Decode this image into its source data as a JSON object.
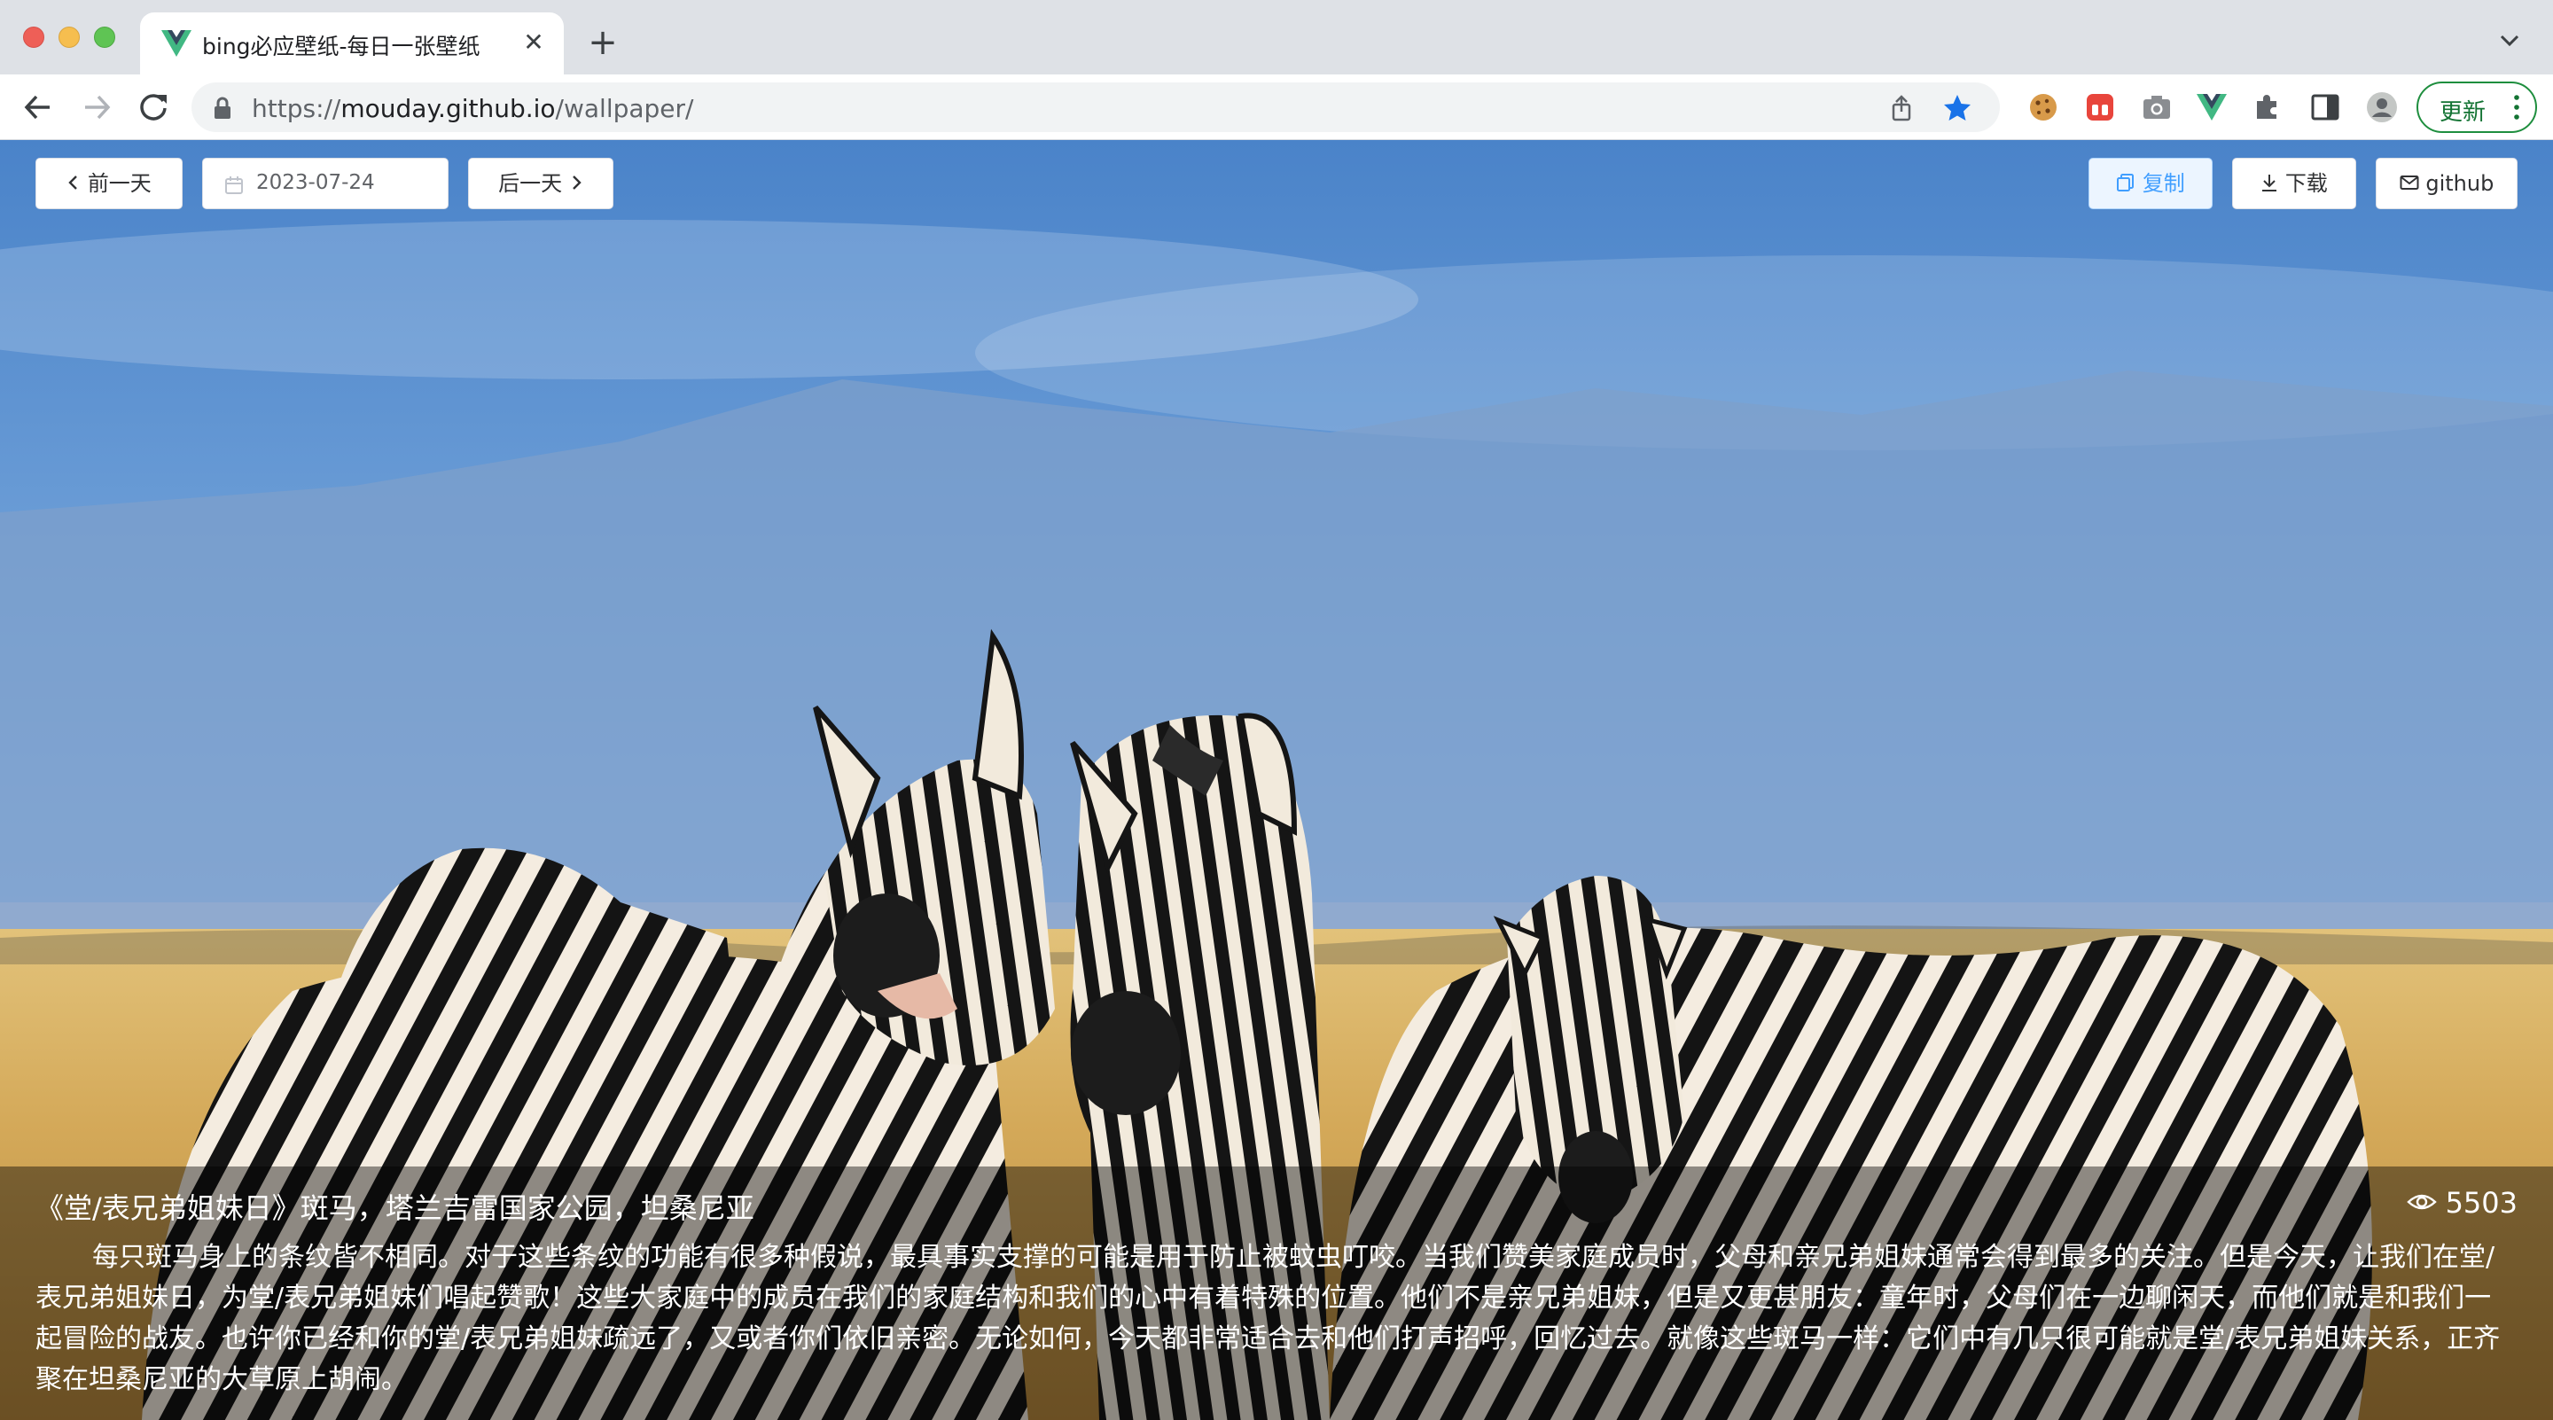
{
  "browser": {
    "tab_title": "bing必应壁纸-每日一张壁纸",
    "url_prefix": "https://",
    "url_host": "mouday.github.io",
    "url_path": "/wallpaper/",
    "update_label": "更新"
  },
  "toolbar": {
    "prev_label": "前一天",
    "date_value": "2023-07-24",
    "next_label": "后一天",
    "copy_label": "复制",
    "download_label": "下载",
    "github_label": "github"
  },
  "caption": {
    "title": "《堂/表兄弟姐妹日》斑马，塔兰吉雷国家公园，坦桑尼亚",
    "views": "5503",
    "description": "每只斑马身上的条纹皆不相同。对于这些条纹的功能有很多种假说，最具事实支撑的可能是用于防止被蚊虫叮咬。当我们赞美家庭成员时，父母和亲兄弟姐妹通常会得到最多的关注。但是今天，让我们在堂/表兄弟姐妹日，为堂/表兄弟姐妹们唱起赞歌！这些大家庭中的成员在我们的家庭结构和我们的心中有着特殊的位置。他们不是亲兄弟姐妹，但是又更甚朋友：童年时，父母们在一边聊闲天，而他们就是和我们一起冒险的战友。也许你已经和你的堂/表兄弟姐妹疏远了，又或者你们依旧亲密。无论如何，今天都非常适合去和他们打声招呼，回忆过去。就像这些斑马一样：它们中有几只很可能就是堂/表兄弟姐妹关系，正齐聚在坦桑尼亚的大草原上胡闹。"
  },
  "icons": {
    "favicon": "vue-logo-icon",
    "prev": "chevron-left-icon",
    "next": "chevron-right-icon",
    "calendar": "calendar-icon",
    "copy": "copy-icon",
    "download": "download-icon",
    "mail": "mail-icon",
    "views": "eye-icon"
  },
  "colors": {
    "primary": "#409eff",
    "update_green": "#1e8e3e",
    "sky": "#5b8ed0",
    "savanna": "#d9b46a"
  }
}
